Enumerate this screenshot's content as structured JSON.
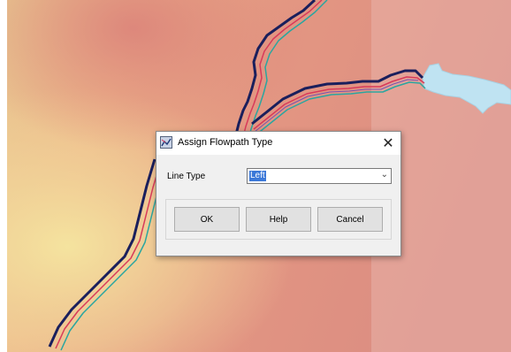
{
  "dialog": {
    "title": "Assign Flowpath Type",
    "close_glyph": "✕",
    "line_type_label": "Line Type",
    "line_type_value": "Left",
    "dropdown_icon": "chevron-down-icon",
    "ok_label": "OK",
    "help_label": "Help",
    "cancel_label": "Cancel"
  },
  "colors": {
    "flowpath_main": "#1a1f5c",
    "flowpath_left": "#d83a5a",
    "flowpath_right": "#2aa6a0",
    "flowpath_extra": "#7a4fb0",
    "water": "#bfe3f2",
    "terrain_red": "#d97f78",
    "terrain_yellow": "#f3e39a"
  }
}
